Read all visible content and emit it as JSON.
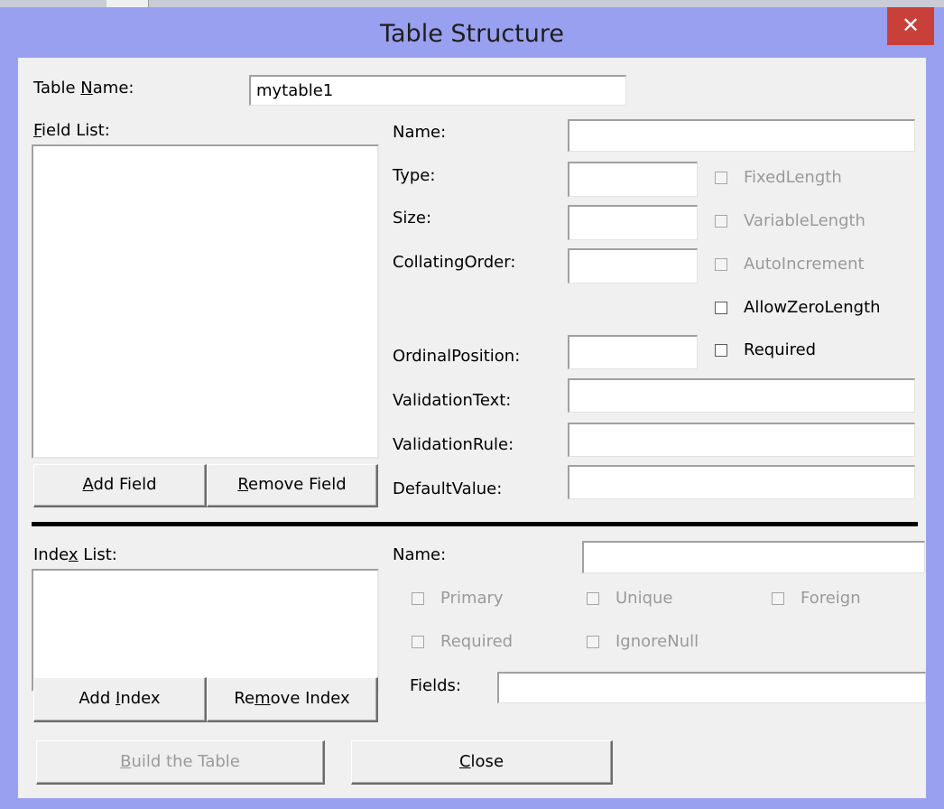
{
  "window": {
    "title": "Table Structure",
    "close_glyph": "✕"
  },
  "table_name": {
    "label_pre": "Table ",
    "label_key": "N",
    "label_post": "ame:",
    "value": "mytable1"
  },
  "field_list": {
    "label_key": "F",
    "label_post": "ield List:"
  },
  "field_props": {
    "name_label": "Name:",
    "type_label": "Type:",
    "size_label": "Size:",
    "collating_label": "CollatingOrder:",
    "ordinal_label": "OrdinalPosition:",
    "validation_text_label": "ValidationText:",
    "validation_rule_label": "ValidationRule:",
    "default_value_label": "DefaultValue:"
  },
  "field_checks": {
    "fixed_length": "FixedLength",
    "variable_length": "VariableLength",
    "auto_increment": "AutoIncrement",
    "allow_zero_length": "AllowZeroLength",
    "required": "Required"
  },
  "field_buttons": {
    "add_key": "A",
    "add_post": "dd Field",
    "remove_key": "R",
    "remove_post": "emove Field"
  },
  "index_list": {
    "label_pre": "Inde",
    "label_key": "x",
    "label_post": " List:"
  },
  "index_props": {
    "name_label": "Name:",
    "fields_label": "Fields:"
  },
  "index_checks": {
    "primary": "Primary",
    "unique": "Unique",
    "foreign": "Foreign",
    "required": "Required",
    "ignore_null": "IgnoreNull"
  },
  "index_buttons": {
    "add_pre": "Add ",
    "add_key": "I",
    "add_post": "ndex",
    "remove_pre": "Re",
    "remove_key": "m",
    "remove_post": "ove Index"
  },
  "bottom_buttons": {
    "build_key": "B",
    "build_post": "uild the Table",
    "close_key": "C",
    "close_post": "lose"
  }
}
